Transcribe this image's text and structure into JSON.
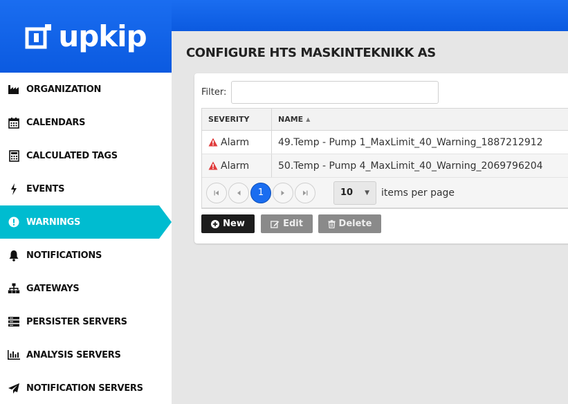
{
  "brand": {
    "name": "upkip",
    "color": "#0b5ae0",
    "accent": "#00bcd0"
  },
  "sidebar": {
    "items": [
      {
        "label": "ORGANIZATION",
        "icon": "factory-icon"
      },
      {
        "label": "CALENDARS",
        "icon": "calendar-icon"
      },
      {
        "label": "CALCULATED TAGS",
        "icon": "calculator-icon"
      },
      {
        "label": "EVENTS",
        "icon": "bolt-icon"
      },
      {
        "label": "WARNINGS",
        "icon": "exclamation-circle-icon",
        "active": true
      },
      {
        "label": "NOTIFICATIONS",
        "icon": "bell-icon"
      },
      {
        "label": "GATEWAYS",
        "icon": "sitemap-icon"
      },
      {
        "label": "PERSISTER SERVERS",
        "icon": "server-icon"
      },
      {
        "label": "ANALYSIS SERVERS",
        "icon": "bar-chart-icon"
      },
      {
        "label": "NOTIFICATION SERVERS",
        "icon": "paper-plane-icon"
      }
    ]
  },
  "page": {
    "title_bold": "CONFIGURE",
    "title_rest": "HTS MASKINTEKNIKK AS"
  },
  "filter": {
    "label": "Filter:",
    "value": "",
    "placeholder": ""
  },
  "grid": {
    "columns": [
      "SEVERITY",
      "NAME"
    ],
    "sort_indicator": "▲",
    "rows": [
      {
        "severity": "Alarm",
        "name": "49.Temp - Pump 1_MaxLimit_40_Warning_1887212912"
      },
      {
        "severity": "Alarm",
        "name": "50.Temp - Pump 4_MaxLimit_40_Warning_2069796204"
      }
    ],
    "pager": {
      "current_page": "1",
      "page_size": "10",
      "page_size_label": "items per page"
    }
  },
  "toolbar": {
    "new_label": "New",
    "edit_label": "Edit",
    "delete_label": "Delete"
  }
}
